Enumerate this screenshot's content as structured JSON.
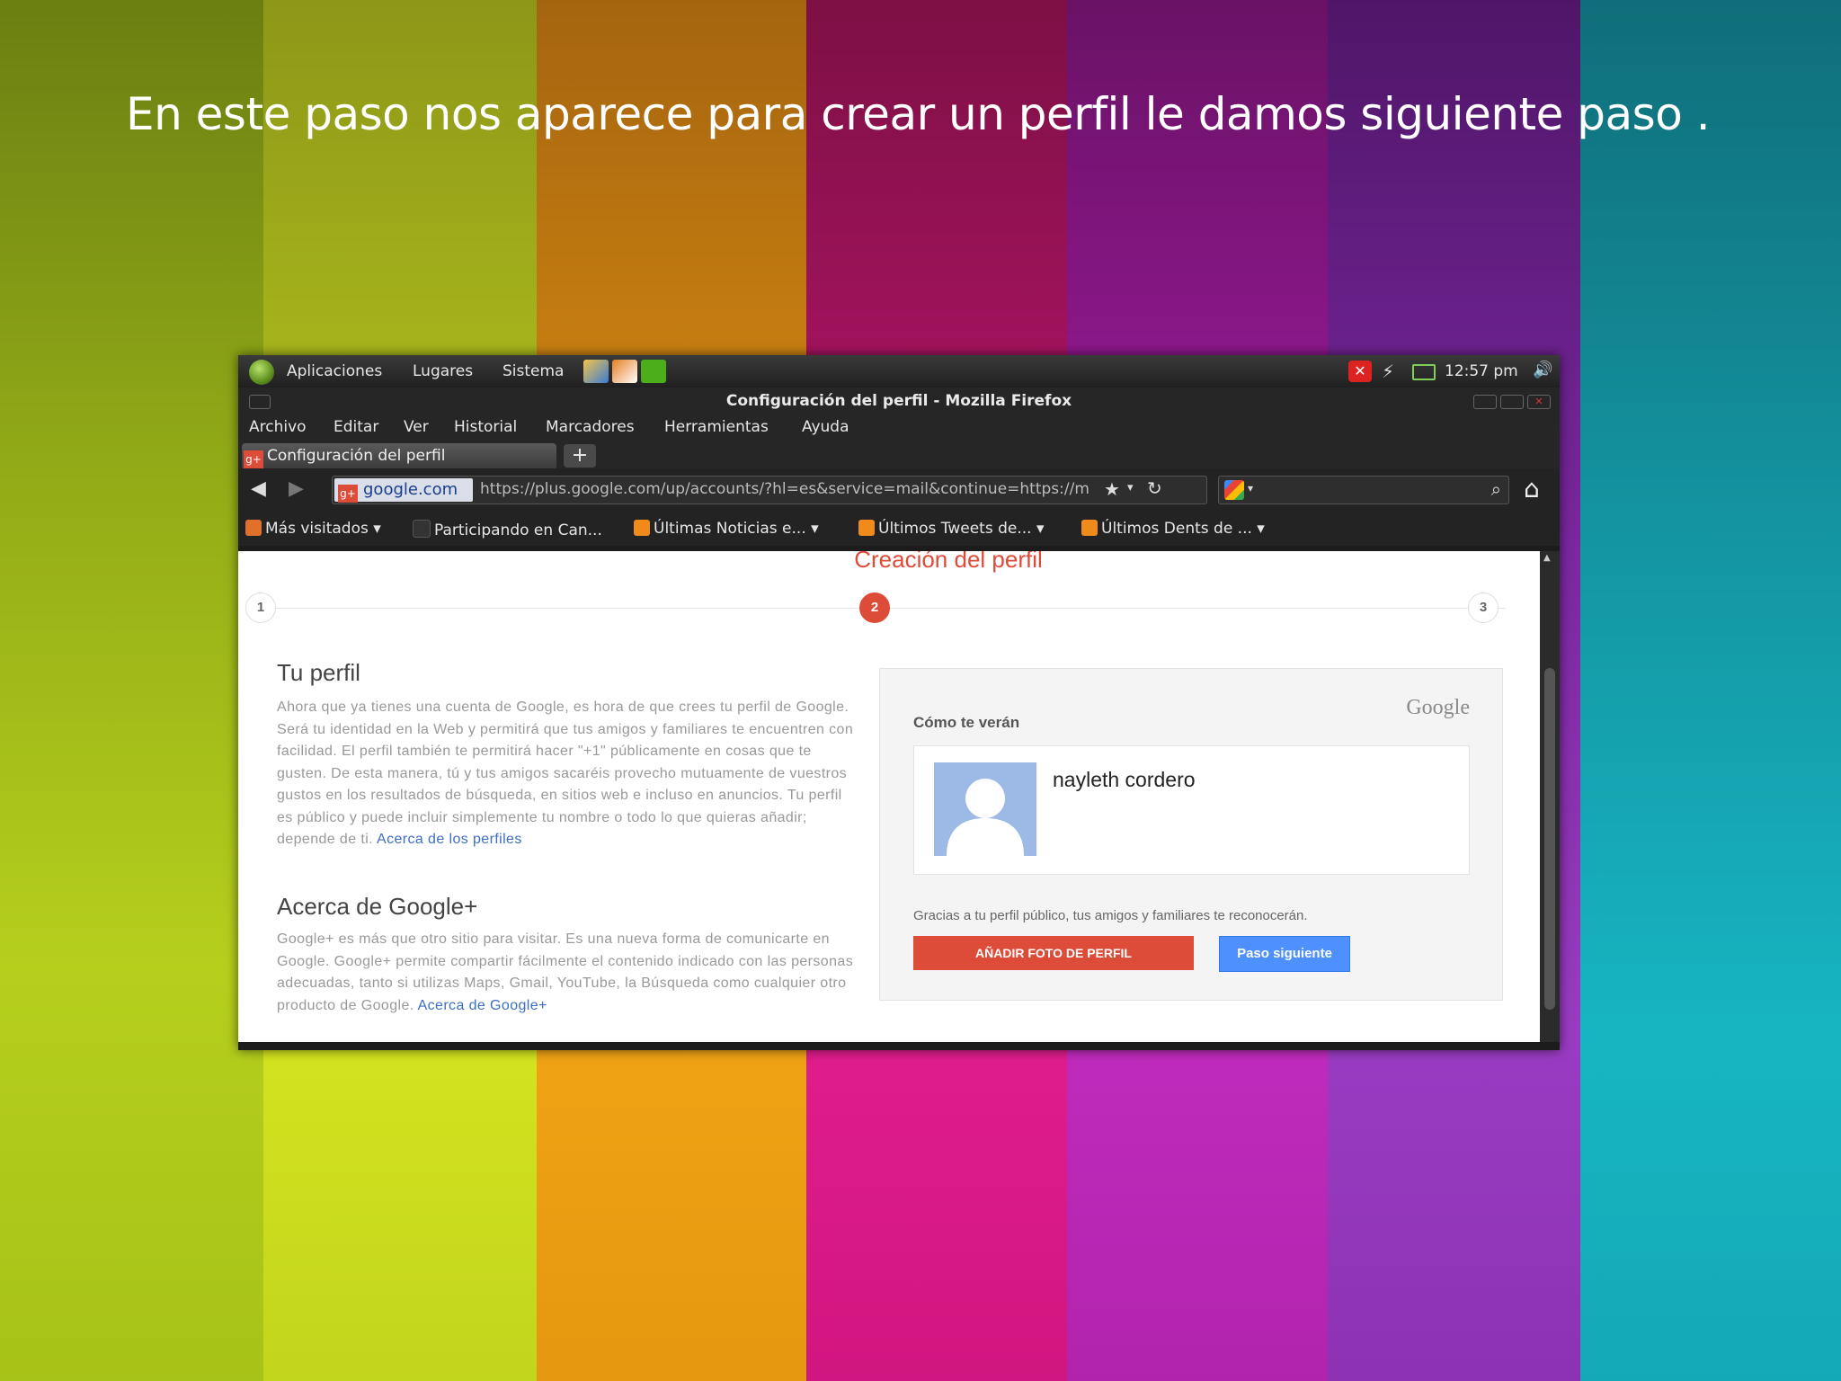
{
  "slide": {
    "headline": "En este paso nos aparece  para crear un perfil le damos siguiente paso ."
  },
  "panel": {
    "menus": [
      "Aplicaciones",
      "Lugares",
      "Sistema"
    ],
    "clock": "12:57 pm"
  },
  "window": {
    "title": "Configuración del perfil - Mozilla Firefox",
    "menu": [
      "Archivo",
      "Editar",
      "Ver",
      "Historial",
      "Marcadores",
      "Herramientas",
      "Ayuda"
    ],
    "tab_label": "Configuración del perfil",
    "new_tab": "+",
    "site_label": "google.com",
    "url": "https://plus.google.com/up/accounts/?hl=es&service=mail&continue=https://m"
  },
  "bookmarks": [
    "Más visitados ▾",
    "Participando en Can...",
    "Últimas Noticias e... ▾",
    "Últimos Tweets de... ▾",
    "Últimos Dents de ... ▾"
  ],
  "page": {
    "title": "Creación del perfil",
    "steps": [
      "1",
      "2",
      "3"
    ],
    "active_step": 2,
    "profile_heading": "Tu perfil",
    "profile_text": "Ahora que ya tienes una cuenta de Google, es hora de que crees tu perfil de Google. Será tu identidad en la Web y permitirá que tus amigos y familiares te encuentren con facilidad. El perfil también te permitirá hacer \"+1\" públicamente en cosas que te gusten. De esta manera, tú y tus amigos sacaréis provecho mutuamente de vuestros gustos en los resultados de búsqueda, en sitios web e incluso en anuncios. Tu perfil es público y puede incluir simplemente tu nombre o todo lo que quieras añadir; depende de ti.",
    "profile_link": "Acerca de los perfiles",
    "about_heading": "Acerca de Google+",
    "about_text": "Google+ es más que otro sitio para visitar. Es una nueva forma de comunicarte en Google. Google+ permite compartir fácilmente el contenido indicado con las personas adecuadas, tanto si utilizas Maps, Gmail, YouTube, la Búsqueda como cualquier otro producto de Google.",
    "about_link": "Acerca de Google+",
    "card": {
      "label": "Cómo te verán",
      "brand": "Google",
      "name": "nayleth cordero",
      "thanks": "Gracias a tu perfil público, tus amigos y familiares te reconocerán.",
      "add_photo": "AÑADIR FOTO DE PERFIL",
      "next": "Paso siguiente"
    }
  },
  "colors": {
    "accent_red": "#dd4b39",
    "accent_blue": "#4d90fe"
  }
}
